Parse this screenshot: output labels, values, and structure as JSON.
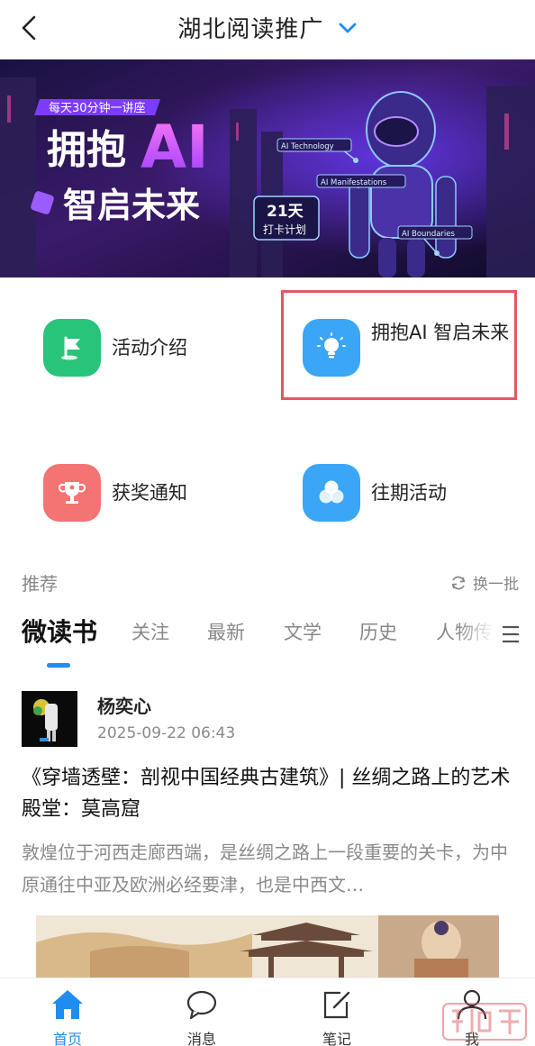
{
  "header": {
    "title": "湖北阅读推广"
  },
  "banner": {
    "top_tag": "每天30分钟一讲座",
    "headline_1": "拥抱",
    "headline_ai": "AI",
    "headline_2": "智启未来",
    "checkin_days": "21天",
    "checkin_label": "打卡计划",
    "tag_1": "AI Technology",
    "tag_2": "AI Manifestations",
    "tag_3": "AI Boundaries"
  },
  "entries": [
    {
      "label": "活动介绍",
      "icon": "flag-icon",
      "color": "#27c479"
    },
    {
      "label": "拥抱AI 智启未来",
      "icon": "lightbulb-icon",
      "color": "#3aa6f5"
    },
    {
      "label": "获奖通知",
      "icon": "trophy-icon",
      "color": "#f47373"
    },
    {
      "label": "往期活动",
      "icon": "circles-icon",
      "color": "#3aa6f5"
    }
  ],
  "recommend": {
    "title": "推荐",
    "refresh_label": "换一批"
  },
  "tabs": [
    "微读书",
    "关注",
    "最新",
    "文学",
    "历史",
    "人物传"
  ],
  "article": {
    "author": "杨奕心",
    "time": "2025-09-22 06:43",
    "title": "《穿墙透壁：剖视中国经典古建筑》| 丝绸之路上的艺术殿堂：莫高窟",
    "summary": "敦煌位于河西走廊西端，是丝绸之路上一段重要的关卡，为中原通往中亚及欧洲必经要津，也是中西文…"
  },
  "bottom_nav": [
    {
      "label": "首页",
      "icon": "home-icon"
    },
    {
      "label": "消息",
      "icon": "message-icon"
    },
    {
      "label": "笔记",
      "icon": "note-icon"
    },
    {
      "label": "我",
      "icon": "person-icon"
    }
  ],
  "colors": {
    "accent": "#1f8cf0",
    "highlight_border": "#e05a5f"
  }
}
